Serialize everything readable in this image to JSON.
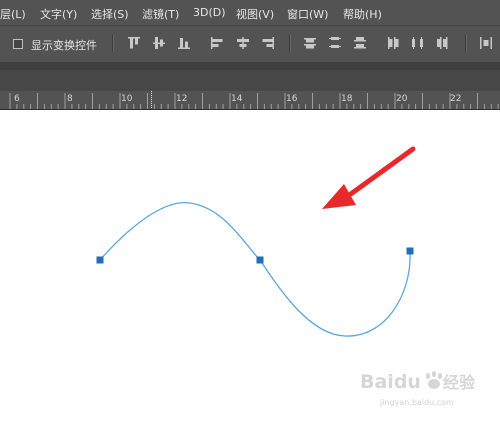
{
  "menubar": {
    "items": [
      {
        "label": "层(L)"
      },
      {
        "label": "文字(Y)"
      },
      {
        "label": "选择(S)"
      },
      {
        "label": "滤镜(T)"
      },
      {
        "label": "3D(D)"
      },
      {
        "label": "视图(V)"
      },
      {
        "label": "窗口(W)"
      },
      {
        "label": "帮助(H)"
      }
    ]
  },
  "options_bar": {
    "show_transform_controls": {
      "label": "显示变换控件",
      "checked": false
    },
    "align_icons": [
      "align-top-edges-icon",
      "align-vertical-centers-icon",
      "align-bottom-edges-icon",
      "align-left-edges-icon",
      "align-horizontal-centers-icon",
      "align-right-edges-icon"
    ],
    "distribute_icons": [
      "distribute-top-edges-icon",
      "distribute-vertical-centers-icon",
      "distribute-bottom-edges-icon",
      "distribute-left-edges-icon",
      "distribute-horizontal-centers-icon",
      "distribute-right-edges-icon"
    ]
  },
  "ruler": {
    "labels": [
      "6",
      "8",
      "10",
      "12",
      "14",
      "16",
      "18",
      "20",
      "22"
    ]
  },
  "canvas": {
    "path_color": "#5aa7dc",
    "anchor_color": "#1d6fbd",
    "arrow_color": "#e8282b"
  },
  "watermark": {
    "brand": "Baidu",
    "logo_text": "经验",
    "url": "jingyan.baidu.com"
  }
}
